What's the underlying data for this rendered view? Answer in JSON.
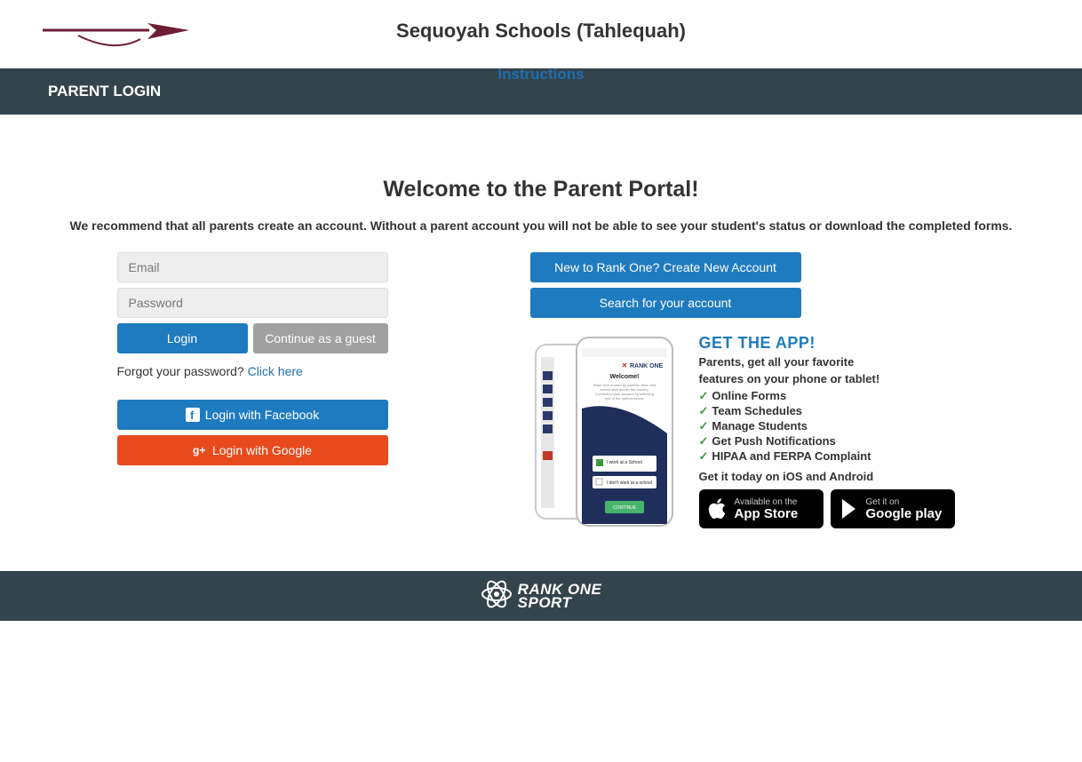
{
  "header": {
    "school_name": "Sequoyah Schools (Tahlequah)",
    "instructions_label": "Instructions"
  },
  "banner": {
    "title": "PARENT LOGIN"
  },
  "main": {
    "welcome_title": "Welcome to the Parent Portal!",
    "welcome_sub": "We recommend that all parents create an account. Without a parent account you will not be able to see your student's status or download the completed forms."
  },
  "login": {
    "email_placeholder": "Email",
    "password_placeholder": "Password",
    "login_label": "Login",
    "guest_label": "Continue as a guest",
    "forgot_text": "Forgot your password?  ",
    "forgot_link": "Click here",
    "facebook_label": "Login with Facebook",
    "google_label": "Login with Google"
  },
  "right": {
    "create_label": "New to Rank One? Create New Account",
    "search_label": "Search for your account"
  },
  "app": {
    "title": "GET THE APP!",
    "sub1": "Parents, get all your favorite",
    "sub2": "features on your phone or tablet!",
    "features": [
      "Online Forms",
      "Team Schedules",
      "Manage Students",
      "Get Push Notifications",
      "HIPAA and FERPA Complaint"
    ],
    "get_today": "Get it today on iOS and Android",
    "appstore_small": "Available on the",
    "appstore_big": "App Store",
    "play_small": "Get it on",
    "play_big": "Google play",
    "phone_brand": "RANK ONE",
    "phone_welcome": "Welcome!",
    "phone_opt1": "I work at a School",
    "phone_opt2": "I don't work at a school",
    "phone_continue": "CONTINUE"
  },
  "footer": {
    "brand_line1": "RANK ONE",
    "brand_line2": "SPORT"
  }
}
